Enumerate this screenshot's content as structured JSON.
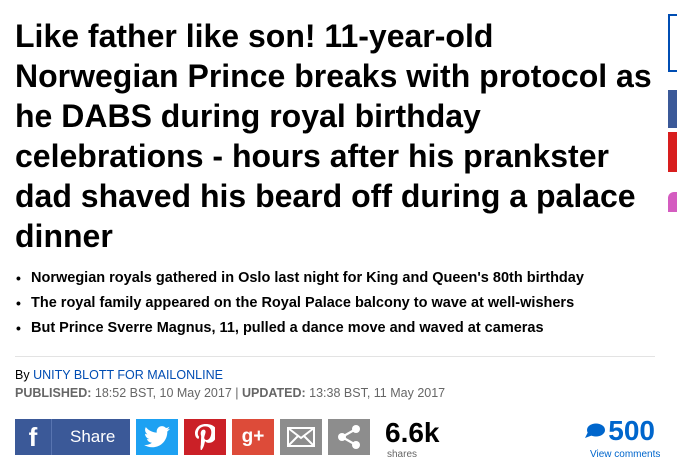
{
  "article": {
    "headline": "Like father like son! 11-year-old Norwegian Prince breaks with protocol as he DABS during royal birthday celebrations - hours after his prankster dad shaved his beard off during a palace dinner",
    "bullets": [
      "Norwegian royals gathered in Oslo last night for King and Queen's 80th birthday",
      "The royal family appeared on the Royal Palace balcony to wave at well-wishers",
      "But Prince Sverre Magnus, 11, pulled a dance move and waved at cameras"
    ],
    "byline_prefix": "By",
    "author": "UNITY BLOTT FOR MAILONLINE",
    "published_label": "PUBLISHED:",
    "published_value": "18:52 BST, 10 May 2017",
    "separator": "|",
    "updated_label": "UPDATED:",
    "updated_value": "13:38 BST, 11 May 2017"
  },
  "share_bar": {
    "facebook_glyph": "f",
    "facebook_label": "Share",
    "googleplus_glyph": "g+",
    "share_count": "6.6k",
    "share_count_label": "shares",
    "comment_count": "500",
    "comments_label": "View comments",
    "icons": [
      "facebook-icon",
      "twitter-icon",
      "pinterest-icon",
      "google-plus-icon",
      "email-icon",
      "share-more-icon",
      "comment-bubble-icon"
    ]
  },
  "colors": {
    "facebook": "#3b5998",
    "twitter": "#1da1f2",
    "pinterest": "#cb2027",
    "google_plus": "#dd4b39",
    "neutral_button": "#8d8d8d",
    "link_blue": "#004db3",
    "comments_blue": "#0066cc"
  }
}
